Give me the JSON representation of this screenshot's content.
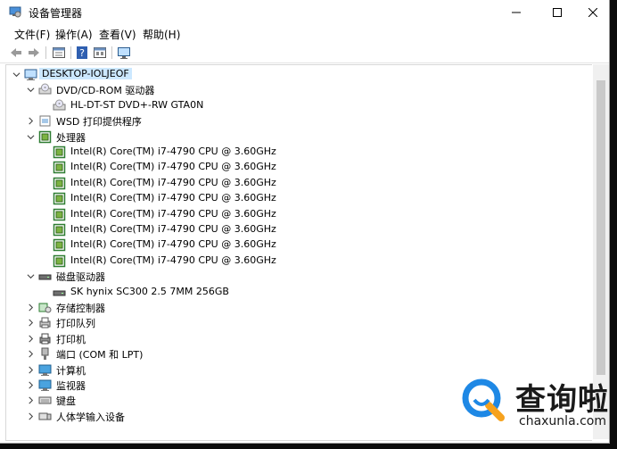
{
  "window": {
    "title": "设备管理器"
  },
  "menu": [
    "文件(F)",
    "操作(A)",
    "查看(V)",
    "帮助(H)"
  ],
  "tree": [
    {
      "label": "DESKTOP-IOLJEOF",
      "level": 0,
      "expander": "expanded",
      "icon": "computer-icon",
      "selected": true
    },
    {
      "label": "DVD/CD-ROM 驱动器",
      "level": 1,
      "expander": "expanded",
      "icon": "dvd-drive-icon"
    },
    {
      "label": "HL-DT-ST DVD+-RW GTA0N",
      "level": 2,
      "expander": "none",
      "icon": "dvd-drive-icon"
    },
    {
      "label": "WSD 打印提供程序",
      "level": 1,
      "expander": "collapsed",
      "icon": "printer-provider-icon"
    },
    {
      "label": "处理器",
      "level": 1,
      "expander": "expanded",
      "icon": "processor-icon"
    },
    {
      "label": "Intel(R) Core(TM) i7-4790 CPU @ 3.60GHz",
      "level": 2,
      "expander": "none",
      "icon": "processor-icon"
    },
    {
      "label": "Intel(R) Core(TM) i7-4790 CPU @ 3.60GHz",
      "level": 2,
      "expander": "none",
      "icon": "processor-icon"
    },
    {
      "label": "Intel(R) Core(TM) i7-4790 CPU @ 3.60GHz",
      "level": 2,
      "expander": "none",
      "icon": "processor-icon"
    },
    {
      "label": "Intel(R) Core(TM) i7-4790 CPU @ 3.60GHz",
      "level": 2,
      "expander": "none",
      "icon": "processor-icon"
    },
    {
      "label": "Intel(R) Core(TM) i7-4790 CPU @ 3.60GHz",
      "level": 2,
      "expander": "none",
      "icon": "processor-icon"
    },
    {
      "label": "Intel(R) Core(TM) i7-4790 CPU @ 3.60GHz",
      "level": 2,
      "expander": "none",
      "icon": "processor-icon"
    },
    {
      "label": "Intel(R) Core(TM) i7-4790 CPU @ 3.60GHz",
      "level": 2,
      "expander": "none",
      "icon": "processor-icon"
    },
    {
      "label": "Intel(R) Core(TM) i7-4790 CPU @ 3.60GHz",
      "level": 2,
      "expander": "none",
      "icon": "processor-icon"
    },
    {
      "label": "磁盘驱动器",
      "level": 1,
      "expander": "expanded",
      "icon": "disk-drive-icon"
    },
    {
      "label": "SK hynix SC300 2.5 7MM 256GB",
      "level": 2,
      "expander": "none",
      "icon": "disk-drive-icon"
    },
    {
      "label": "存储控制器",
      "level": 1,
      "expander": "collapsed",
      "icon": "storage-controller-icon"
    },
    {
      "label": "打印队列",
      "level": 1,
      "expander": "collapsed",
      "icon": "print-queue-icon"
    },
    {
      "label": "打印机",
      "level": 1,
      "expander": "collapsed",
      "icon": "printer-icon"
    },
    {
      "label": "端口 (COM 和 LPT)",
      "level": 1,
      "expander": "collapsed",
      "icon": "port-icon"
    },
    {
      "label": "计算机",
      "level": 1,
      "expander": "collapsed",
      "icon": "monitor-icon"
    },
    {
      "label": "监视器",
      "level": 1,
      "expander": "collapsed",
      "icon": "monitor-icon"
    },
    {
      "label": "键盘",
      "level": 1,
      "expander": "collapsed",
      "icon": "keyboard-icon"
    },
    {
      "label": "人体学输入设备",
      "level": 1,
      "expander": "collapsed",
      "icon": "hid-icon"
    }
  ],
  "watermark": {
    "name": "查询啦",
    "url": "chaxunla.com"
  },
  "colors": {
    "selection": "#cce8ff",
    "processor": "#2e7d32",
    "logo": "#1e88e5"
  }
}
